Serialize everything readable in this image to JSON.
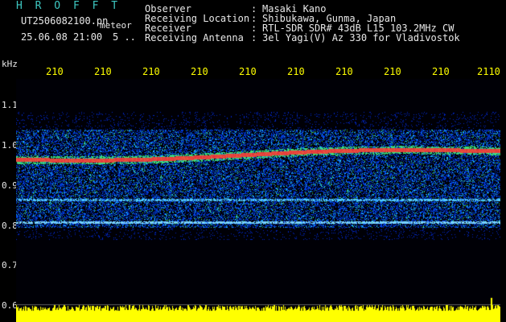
{
  "header": {
    "app_logo": "H R O F F T",
    "filename": "UT2506082100.pn",
    "mode": "meteor",
    "datetime": "25.06.08 21:00",
    "dwell": "5 ..",
    "fields": [
      {
        "label": "Observer",
        "value": "Masaki Kano"
      },
      {
        "label": "Receiving Location",
        "value": "Shibukawa, Gunma, Japan"
      },
      {
        "label": "Receiver",
        "value": "RTL-SDR SDR# 43dB L15 103.2MHz CW"
      },
      {
        "label": "Receiving Antenna",
        "value": "3el Yagi(V) Az 330 for Vladivostok"
      }
    ],
    "separator": ":"
  },
  "spectrogram": {
    "unit": "kHz",
    "x_ticks": [
      "210",
      "210",
      "210",
      "210",
      "210",
      "210",
      "210",
      "210",
      "210",
      "2110"
    ],
    "y_ticks": [
      "1.1",
      "1.0",
      "0.9",
      "0.8",
      "0.7",
      "0.6"
    ],
    "colors": {
      "background": "#000008",
      "noise": "#1a3cff",
      "signal": "#ff2020",
      "power_bar": "#ffff00"
    }
  }
}
